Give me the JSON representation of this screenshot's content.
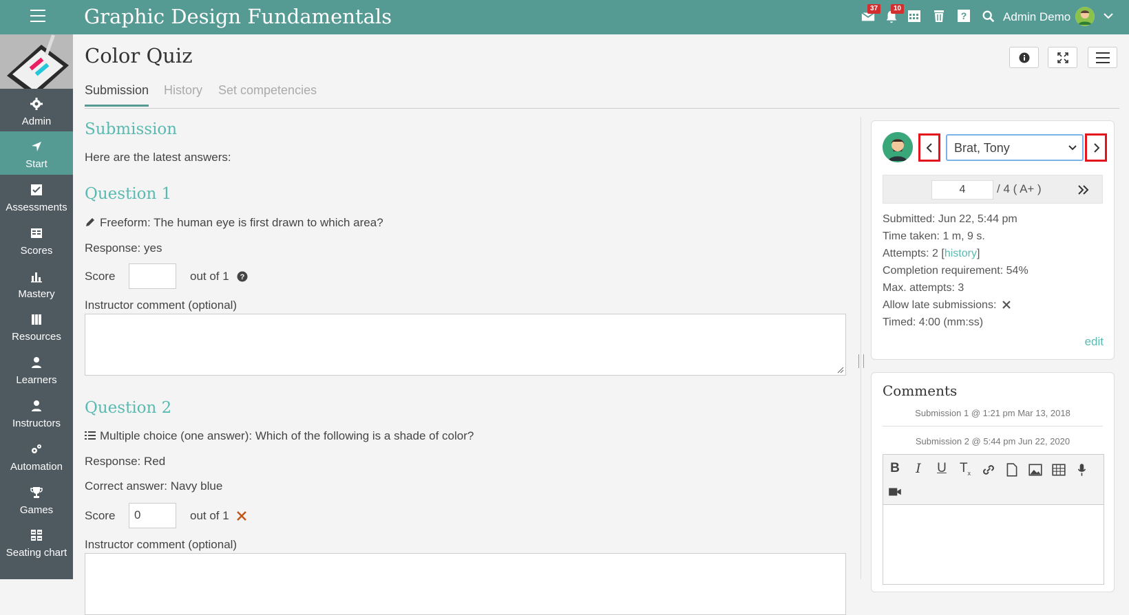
{
  "app": {
    "title": "Graphic Design Fundamentals"
  },
  "header": {
    "messages_badge": "37",
    "notifications_badge": "10",
    "username": "Admin Demo",
    "icons": [
      "mail-icon",
      "bell-icon",
      "calendar-icon",
      "trash-icon",
      "help-icon",
      "search-icon",
      "chevron-down-icon"
    ]
  },
  "sidebar": {
    "items": [
      {
        "label": "Admin",
        "icon": "gear-icon"
      },
      {
        "label": "Start",
        "icon": "navigation-arrow-icon"
      },
      {
        "label": "Assessments",
        "icon": "checkbox-icon"
      },
      {
        "label": "Scores",
        "icon": "gradebook-icon"
      },
      {
        "label": "Mastery",
        "icon": "bar-chart-icon"
      },
      {
        "label": "Resources",
        "icon": "books-icon"
      },
      {
        "label": "Learners",
        "icon": "person-icon"
      },
      {
        "label": "Instructors",
        "icon": "instructor-icon"
      },
      {
        "label": "Automation",
        "icon": "gears-icon"
      },
      {
        "label": "Games",
        "icon": "trophy-icon"
      },
      {
        "label": "Seating chart",
        "icon": "seating-icon"
      }
    ],
    "active": "Start"
  },
  "page": {
    "title": "Color Quiz",
    "tabs": [
      "Submission",
      "History",
      "Set competencies"
    ],
    "active_tab": "Submission"
  },
  "submission": {
    "heading": "Submission",
    "intro": "Here are the latest answers:",
    "questions": [
      {
        "heading": "Question 1",
        "text": "Freeform: The human eye is first drawn to which area?",
        "response": "Response: yes",
        "score_label": "Score",
        "score_value": "",
        "out_of": "out of 1",
        "comment_label": "Instructor comment (optional)"
      },
      {
        "heading": "Question 2",
        "text": "Multiple choice (one answer): Which of the following is a shade of color?",
        "response": "Response: Red",
        "correct": "Correct answer: Navy blue",
        "score_label": "Score",
        "score_value": "0",
        "out_of": "out of 1",
        "comment_label": "Instructor comment (optional)"
      }
    ]
  },
  "student_panel": {
    "student": "Brat, Tony",
    "page_current": "4",
    "page_total": "/ 4 ( A+ )",
    "submitted": "Submitted: Jun 22, 5:44 pm",
    "time_taken": "Time taken: 1 m, 9 s.",
    "attempts_prefix": "Attempts: 2 [",
    "attempts_link": "history",
    "attempts_suffix": "]",
    "completion": "Completion requirement: 54%",
    "max_attempts": "Max. attempts: 3",
    "late": "Allow late submissions:",
    "timed": "Timed: 4:00 (mm:ss)",
    "edit": "edit"
  },
  "comments": {
    "title": "Comments",
    "submissions": [
      "Submission 1 @ 1:21 pm Mar 13, 2018",
      "Submission 2 @ 5:44 pm Jun 22, 2020"
    ],
    "toolbar": [
      "bold-icon",
      "italic-icon",
      "underline-icon",
      "remove-format-icon",
      "link-icon",
      "document-icon",
      "image-icon",
      "table-icon",
      "microphone-icon",
      "video-icon"
    ]
  },
  "colors": {
    "accent": "#559a93",
    "link": "#5bbab0",
    "sidebar": "#4e5960",
    "highlight": "#e3141b"
  }
}
